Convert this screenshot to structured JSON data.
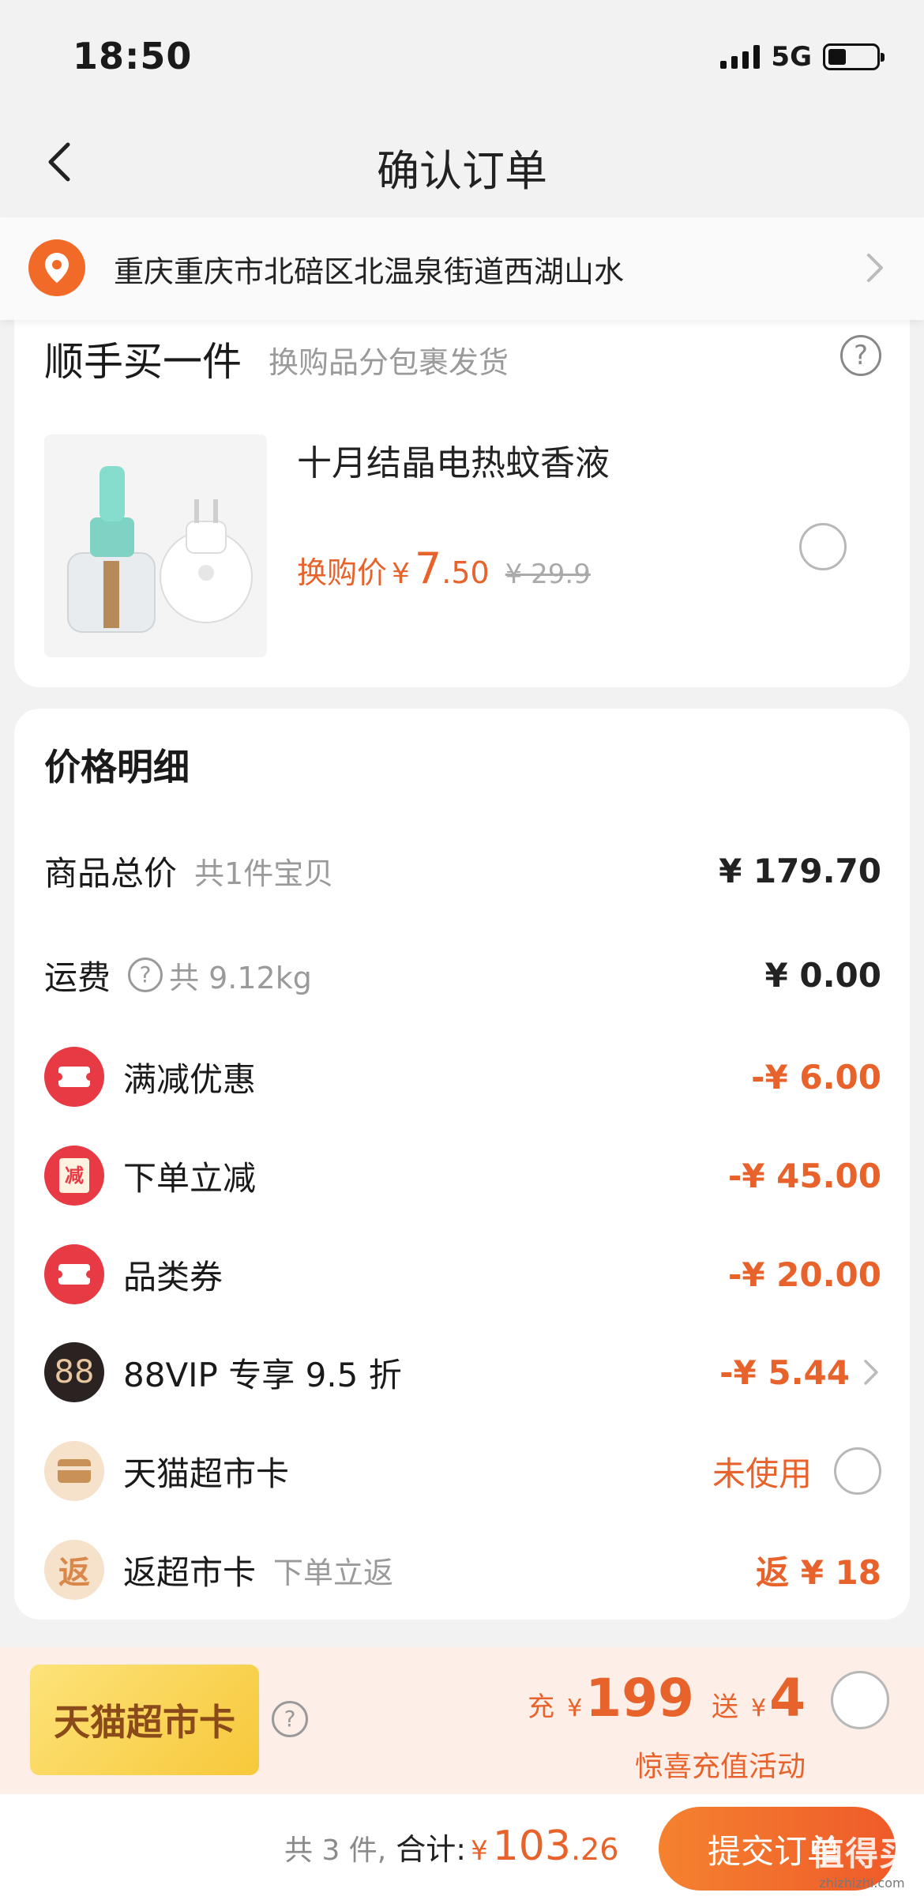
{
  "status_bar": {
    "time": "18:50",
    "network": "5G"
  },
  "nav": {
    "title": "确认订单"
  },
  "address": {
    "text": "重庆重庆市北碚区北温泉街道西湖山水"
  },
  "addon": {
    "title": "顺手买一件",
    "subtitle": "换购品分包裹发货",
    "help": "?",
    "product": {
      "name": "十月结晶电热蚊香液",
      "price_label": "换购价",
      "currency": "¥",
      "price_int": "7",
      "price_dec": ".50",
      "original_price": "¥ 29.9"
    }
  },
  "price_detail": {
    "title": "价格明细",
    "goods_total": {
      "label": "商品总价",
      "sub": "共1件宝贝",
      "value": "¥ 179.70"
    },
    "shipping": {
      "label": "运费",
      "help": "?",
      "sub": "共 9.12kg",
      "value": "¥ 0.00"
    },
    "full_reduction": {
      "label": "满减优惠",
      "value": "-¥ 6.00"
    },
    "order_discount": {
      "label": "下单立减",
      "badge": "减",
      "value": "-¥ 45.00"
    },
    "category_coupon": {
      "label": "品类券",
      "value": "-¥ 20.00"
    },
    "vip": {
      "label": "88VIP 专享 9.5 折",
      "badge": "88",
      "value": "-¥ 5.44"
    },
    "tmall_card": {
      "label": "天猫超市卡",
      "value": "未使用"
    },
    "cashback": {
      "label": "返超市卡",
      "badge": "返",
      "sub": "下单立返",
      "value": "返 ¥ 18"
    }
  },
  "promo": {
    "card_label": "天猫超市卡",
    "help": "?",
    "recharge_word": "充",
    "recharge_currency": "¥",
    "recharge_amount": "199",
    "gift_word": "送",
    "gift_currency": "¥",
    "gift_amount": "4",
    "subtitle": "惊喜充值活动"
  },
  "footer": {
    "count": "共 3 件,",
    "total_label": "合计:",
    "currency": "¥",
    "total_int": "103",
    "total_dec": ".26",
    "submit_label": "提交订单"
  },
  "watermark": {
    "main": "值得买",
    "sub": "zhizhizhi.com"
  },
  "colors": {
    "accent": "#e8632b",
    "coupon_red": "#e83a44",
    "page_bg": "#f2f2f2"
  }
}
